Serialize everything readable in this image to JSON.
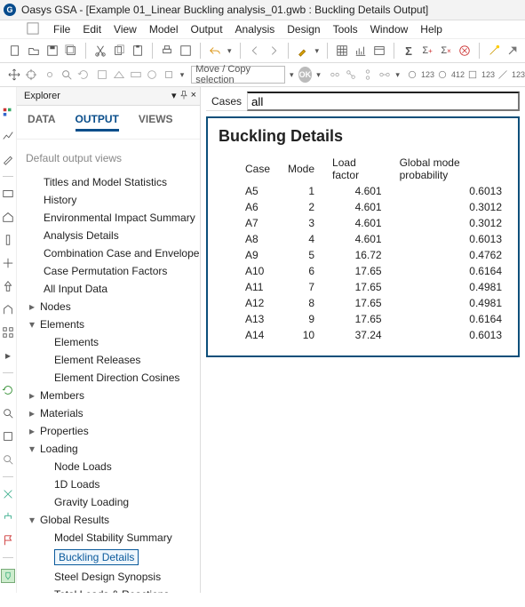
{
  "title": "Oasys GSA - [Example 01_Linear Buckling analysis_01.gwb : Buckling Details Output]",
  "app_icon_letter": "G",
  "menu": [
    "File",
    "Edit",
    "View",
    "Model",
    "Output",
    "Analysis",
    "Design",
    "Tools",
    "Window",
    "Help"
  ],
  "toolbar2": {
    "move_copy_label": "Move / Copy selection",
    "ok_label": "OK",
    "u_labels": [
      "123",
      "412",
      "123",
      "123"
    ]
  },
  "explorer": {
    "title": "Explorer",
    "tabs": [
      "DATA",
      "OUTPUT",
      "VIEWS"
    ],
    "active_tab": 1,
    "default_views_label": "Default output views",
    "items": [
      {
        "label": "Titles and Model Statistics"
      },
      {
        "label": "History"
      },
      {
        "label": "Environmental Impact Summary"
      },
      {
        "label": "Analysis Details"
      },
      {
        "label": "Combination Case and Envelope D"
      },
      {
        "label": "Case Permutation Factors"
      },
      {
        "label": "All Input Data"
      },
      {
        "label": "Nodes",
        "parent": true,
        "expanded": false
      },
      {
        "label": "Elements",
        "parent": true,
        "expanded": true,
        "children": [
          {
            "label": "Elements"
          },
          {
            "label": "Element Releases"
          },
          {
            "label": "Element Direction Cosines"
          }
        ]
      },
      {
        "label": "Members",
        "parent": true,
        "expanded": false
      },
      {
        "label": "Materials",
        "parent": true,
        "expanded": false
      },
      {
        "label": "Properties",
        "parent": true,
        "expanded": false
      },
      {
        "label": "Loading",
        "parent": true,
        "expanded": true,
        "children": [
          {
            "label": "Node Loads"
          },
          {
            "label": "1D Loads"
          },
          {
            "label": "Gravity Loading"
          }
        ]
      },
      {
        "label": "Global Results",
        "parent": true,
        "expanded": true,
        "children": [
          {
            "label": "Model Stability Summary"
          },
          {
            "label": "Buckling Details",
            "selected": true
          },
          {
            "label": "Steel Design Synopsis"
          },
          {
            "label": "Total Loads & Reactions"
          }
        ]
      }
    ]
  },
  "cases": {
    "label": "Cases",
    "value": "all"
  },
  "panel": {
    "title": "Buckling Details",
    "headers": [
      "Case",
      "Mode",
      "Load factor",
      "Global mode probability"
    ],
    "rows": [
      [
        "A5",
        "1",
        "4.601",
        "0.6013"
      ],
      [
        "A6",
        "2",
        "4.601",
        "0.3012"
      ],
      [
        "A7",
        "3",
        "4.601",
        "0.3012"
      ],
      [
        "A8",
        "4",
        "4.601",
        "0.6013"
      ],
      [
        "A9",
        "5",
        "16.72",
        "0.4762"
      ],
      [
        "A10",
        "6",
        "17.65",
        "0.6164"
      ],
      [
        "A11",
        "7",
        "17.65",
        "0.4981"
      ],
      [
        "A12",
        "8",
        "17.65",
        "0.4981"
      ],
      [
        "A13",
        "9",
        "17.65",
        "0.6164"
      ],
      [
        "A14",
        "10",
        "37.24",
        "0.6013"
      ]
    ]
  }
}
